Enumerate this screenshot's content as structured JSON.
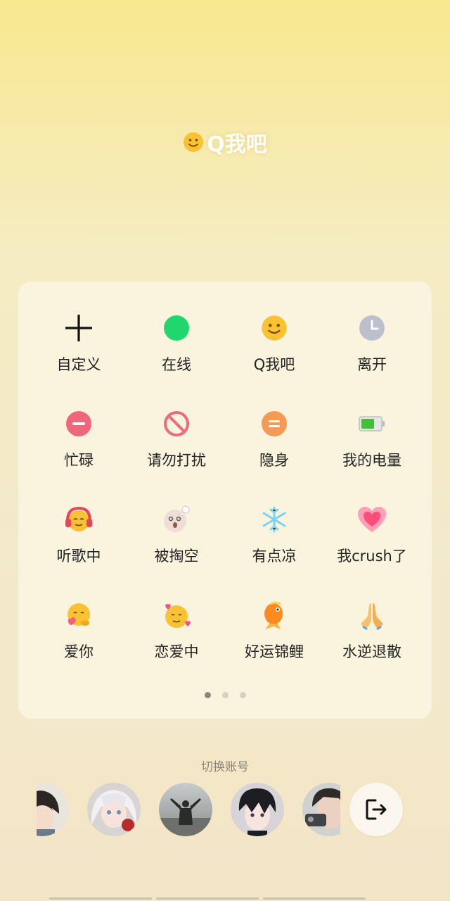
{
  "current_status": {
    "icon": "smile-emoji-icon",
    "label": "Q我吧"
  },
  "status_grid": [
    {
      "label": "自定义",
      "icon": "plus-icon"
    },
    {
      "label": "在线",
      "icon": "online-green-dot-icon"
    },
    {
      "label": "Q我吧",
      "icon": "smile-emoji-icon"
    },
    {
      "label": "离开",
      "icon": "clock-icon"
    },
    {
      "label": "忙碌",
      "icon": "busy-minus-icon"
    },
    {
      "label": "请勿打扰",
      "icon": "do-not-disturb-icon"
    },
    {
      "label": "隐身",
      "icon": "invisible-equals-icon"
    },
    {
      "label": "我的电量",
      "icon": "battery-icon"
    },
    {
      "label": "听歌中",
      "icon": "headphones-emoji-icon"
    },
    {
      "label": "被掏空",
      "icon": "drained-emoji-icon"
    },
    {
      "label": "有点凉",
      "icon": "snowflake-icon"
    },
    {
      "label": "我crush了",
      "icon": "pink-heart-icon"
    },
    {
      "label": "爱你",
      "icon": "hugging-emoji-icon"
    },
    {
      "label": "恋爱中",
      "icon": "in-love-emoji-icon"
    },
    {
      "label": "好运锦鲤",
      "icon": "koi-fish-icon"
    },
    {
      "label": "水逆退散",
      "icon": "praying-hands-icon"
    }
  ],
  "pagination": {
    "total": 3,
    "active": 1
  },
  "account_switch": {
    "title": "切换账号",
    "accounts": [
      "avatar-1",
      "avatar-2",
      "avatar-3",
      "avatar-4",
      "avatar-5"
    ],
    "exit_icon": "exit-arrow-icon"
  },
  "colors": {
    "online": "#22d66e",
    "busy": "#f0667a",
    "dnd": "#ee6b7b",
    "invisible": "#f59a55",
    "away": "#bcc0cc"
  }
}
